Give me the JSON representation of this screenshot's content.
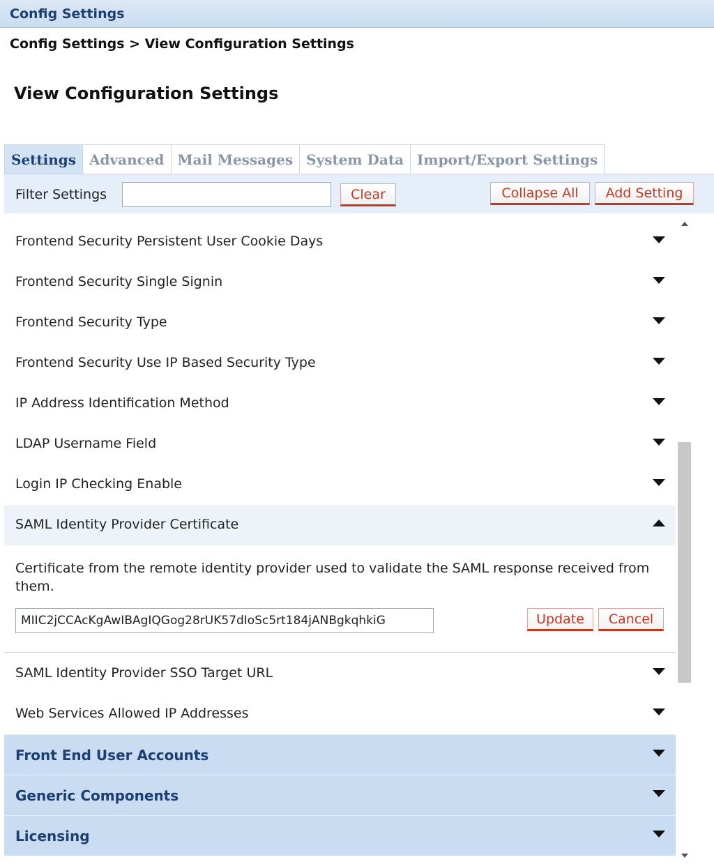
{
  "header": {
    "title": "Config Settings"
  },
  "breadcrumb": "Config Settings > View Configuration Settings",
  "page_title": "View Configuration Settings",
  "tabs": [
    {
      "label": "Settings",
      "active": true
    },
    {
      "label": "Advanced",
      "active": false
    },
    {
      "label": "Mail Messages",
      "active": false
    },
    {
      "label": "System Data",
      "active": false
    },
    {
      "label": "Import/Export Settings",
      "active": false
    }
  ],
  "filter": {
    "label": "Filter Settings",
    "value": "",
    "clear_label": "Clear",
    "collapse_all_label": "Collapse All",
    "add_setting_label": "Add Setting"
  },
  "settings": [
    {
      "label": "Frontend Security Persistent User Cookie Days"
    },
    {
      "label": "Frontend Security Single Signin"
    },
    {
      "label": "Frontend Security Type"
    },
    {
      "label": "Frontend Security Use IP Based Security Type"
    },
    {
      "label": "IP Address Identification Method"
    },
    {
      "label": "LDAP Username Field"
    },
    {
      "label": "Login IP Checking Enable"
    }
  ],
  "expanded_setting": {
    "label": "SAML Identity Provider Certificate",
    "description": "Certificate from the remote identity provider used to validate the SAML response received from them.",
    "value": "MIIC2jCCAcKgAwIBAgIQGog28rUK57dIoSc5rt184jANBgkqhkiG",
    "update_label": "Update",
    "cancel_label": "Cancel"
  },
  "settings_after": [
    {
      "label": "SAML Identity Provider SSO Target URL"
    },
    {
      "label": "Web Services Allowed IP Addresses"
    }
  ],
  "categories": [
    {
      "label": "Front End User Accounts"
    },
    {
      "label": "Generic Components"
    },
    {
      "label": "Licensing"
    }
  ],
  "colors": {
    "header_bg": "#c9dcf1",
    "accent_red": "#c8361f",
    "title_blue": "#1c3f73"
  }
}
